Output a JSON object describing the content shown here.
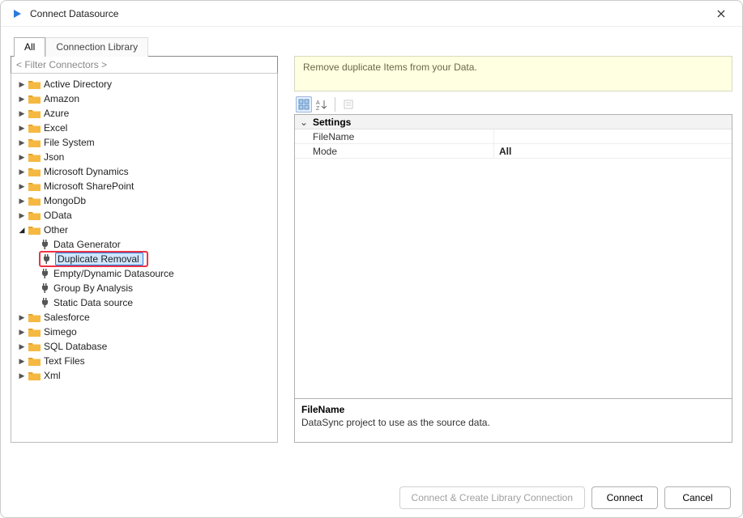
{
  "window": {
    "title": "Connect Datasource"
  },
  "tabs": {
    "all": "All",
    "library": "Connection Library"
  },
  "filter_placeholder": "< Filter Connectors >",
  "tree": {
    "top": [
      "Active Directory",
      "Amazon",
      "Azure",
      "Excel",
      "File System",
      "Json",
      "Microsoft Dynamics",
      "Microsoft SharePoint",
      "MongoDb",
      "OData"
    ],
    "other_label": "Other",
    "other_children": [
      "Data Generator",
      "Duplicate Removal",
      "Empty/Dynamic Datasource",
      "Group By Analysis",
      "Static Data source"
    ],
    "bottom": [
      "Salesforce",
      "Simego",
      "SQL Database",
      "Text Files",
      "Xml"
    ]
  },
  "description": "Remove duplicate Items from your Data.",
  "properties": {
    "header": "Settings",
    "rows": [
      {
        "name": "FileName",
        "value": ""
      },
      {
        "name": "Mode",
        "value": "All"
      }
    ]
  },
  "prop_help": {
    "title": "FileName",
    "body": "DataSync project to use as the source data."
  },
  "buttons": {
    "create_lib": "Connect & Create Library Connection",
    "connect": "Connect",
    "cancel": "Cancel"
  }
}
